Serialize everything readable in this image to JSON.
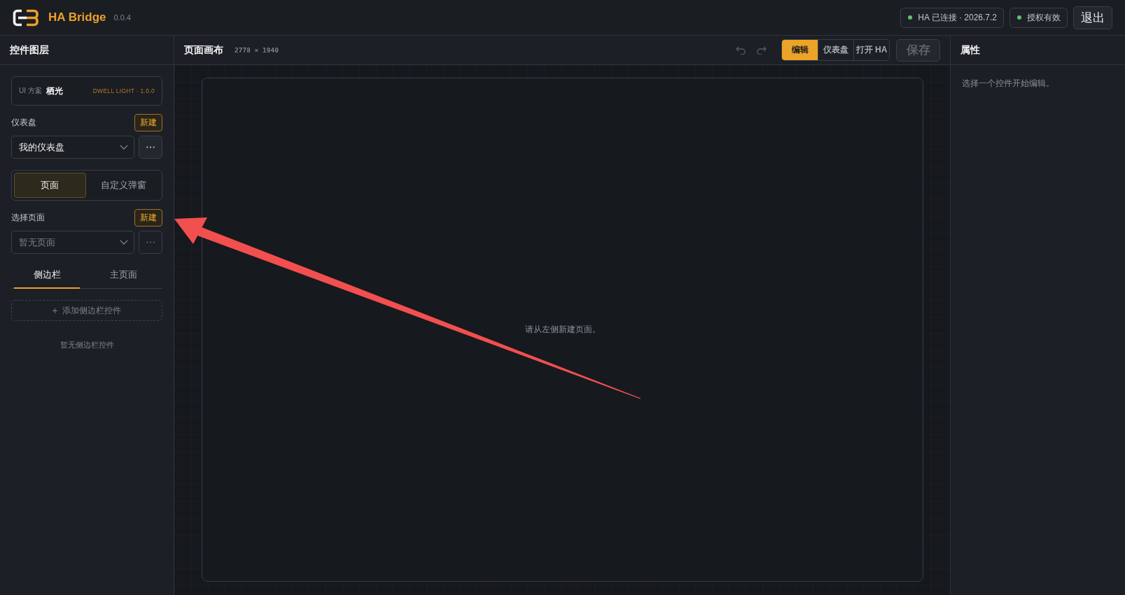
{
  "header": {
    "app_name": "HA Bridge",
    "version": "0.0.4",
    "status_pills": [
      {
        "label": "HA 已连接 · 2026.7.2",
        "color": "#5cc46a"
      },
      {
        "label": "授权有效",
        "color": "#5cc46a"
      }
    ],
    "logout_button": "退出"
  },
  "layers_panel": {
    "title": "控件图层",
    "scheme": {
      "label": "UI 方案",
      "name": "栖光",
      "meta": "DWELL LIGHT · 1.0.0"
    },
    "dashboard": {
      "label": "仪表盘",
      "new_button": "新建",
      "select": {
        "value": "我的仪表盘"
      },
      "more_button": {
        "disabled": false
      }
    },
    "mode_tabs": [
      {
        "label": "页面",
        "selected": true
      },
      {
        "label": "自定义弹窗",
        "selected": false
      }
    ],
    "page_select": {
      "label": "选择页面",
      "new_button": "新建",
      "select": {
        "placeholder": "暂无页面"
      },
      "more_button": {
        "disabled": true
      }
    },
    "area_tabs": [
      {
        "label": "侧边栏",
        "selected": true
      },
      {
        "label": "主页面",
        "selected": false
      }
    ],
    "add_button": "添加侧边栏控件",
    "empty_text": "暂无侧边栏控件"
  },
  "canvas": {
    "title": "页面画布",
    "size": "2778 × 1940",
    "undo": {
      "disabled": true
    },
    "redo": {
      "disabled": true
    },
    "view_tabs": [
      {
        "label": "编辑",
        "selected": true
      },
      {
        "label": "仪表盘",
        "selected": false
      },
      {
        "label": "打开 HA",
        "selected": false
      }
    ],
    "save_button": {
      "label": "保存",
      "disabled": true
    },
    "empty_message": "请从左侧新建页面。"
  },
  "properties_panel": {
    "title": "属性",
    "hint": "选择一个控件开始编辑。"
  },
  "annotations": [
    {
      "kind": "arrow"
    }
  ]
}
